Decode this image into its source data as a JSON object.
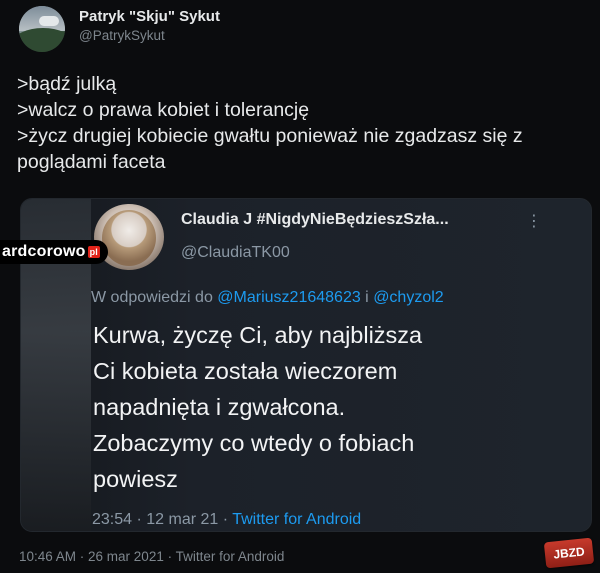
{
  "author": {
    "name": "Patryk \"Skju\" Sykut",
    "handle": "@PatrykSykut"
  },
  "tweet": {
    "text": ">bądź julką\n>walcz o prawa kobiet i tolerancję\n>życz drugiej kobiecie gwałtu ponieważ nie zgadzasz się z poglądami faceta",
    "timestamp": "10:46 AM · 26 mar 2021 · Twitter for Android"
  },
  "quoted": {
    "name": "Claudia J #NigdyNieBędzieszSzła...",
    "more": "⋮",
    "handle": "@ClaudiaTK00",
    "reply_prefix": "W odpowiedzi do ",
    "reply_mention_1": "@Mariusz21648623",
    "reply_join": " i ",
    "reply_mention_2": "@chyzol2",
    "body_lines": [
      "Kurwa, życzę Ci, aby najbliższa",
      "Ci kobieta została wieczorem",
      "napadnięta i zgwałcona.",
      "Zobaczymy co wtedy o fobiach",
      "powiesz"
    ],
    "meta_time": "23:54 · 12 mar 21 · ",
    "meta_app": "Twitter for Android"
  },
  "watermark": {
    "text": "ardcorowo",
    "suffix": "pl"
  },
  "badge": {
    "text": "JBZD"
  },
  "colors": {
    "background": "#0b0c0e",
    "link": "#1d9bf0",
    "secondary_text": "#8b98a5"
  },
  "icons": {
    "more": "more-vertical-icon"
  }
}
